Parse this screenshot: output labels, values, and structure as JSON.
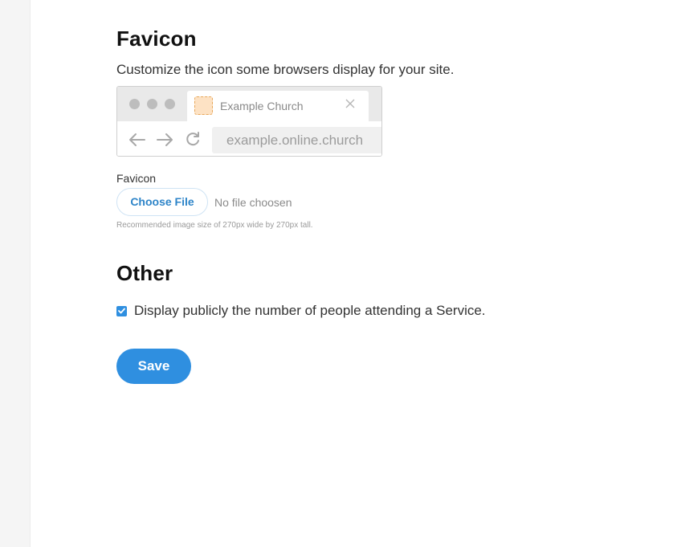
{
  "favicon_section": {
    "title": "Favicon",
    "description": "Customize the icon some browsers display for your site.",
    "preview": {
      "tab_title": "Example Church",
      "url": "example.online.church"
    },
    "field_label": "Favicon",
    "choose_file_label": "Choose File",
    "file_status": "No file choosen",
    "hint": "Recommended image size of 270px wide by 270px tall."
  },
  "other_section": {
    "title": "Other",
    "checkbox": {
      "label": "Display publicly the number of people attending a Service.",
      "checked": true
    }
  },
  "actions": {
    "save_label": "Save"
  },
  "colors": {
    "accent": "#2f8fe0",
    "favicon_placeholder": "#fde2c4"
  }
}
